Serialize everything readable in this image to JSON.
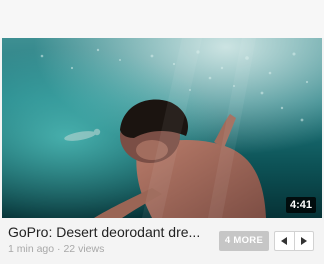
{
  "video": {
    "title": "GoPro: Desert deorodant dre...",
    "duration": "4:41",
    "age": "1 min ago",
    "views": "22 views",
    "meta_separator": "·"
  },
  "controls": {
    "more_label": "4 MORE",
    "prev_icon": "triangle-left-icon",
    "next_icon": "triangle-right-icon"
  },
  "colors": {
    "water_deep": "#0b4146",
    "water_light": "#2f9a9a",
    "skin": "#a36a5a",
    "more_button_bg": "#c6c6c6"
  }
}
